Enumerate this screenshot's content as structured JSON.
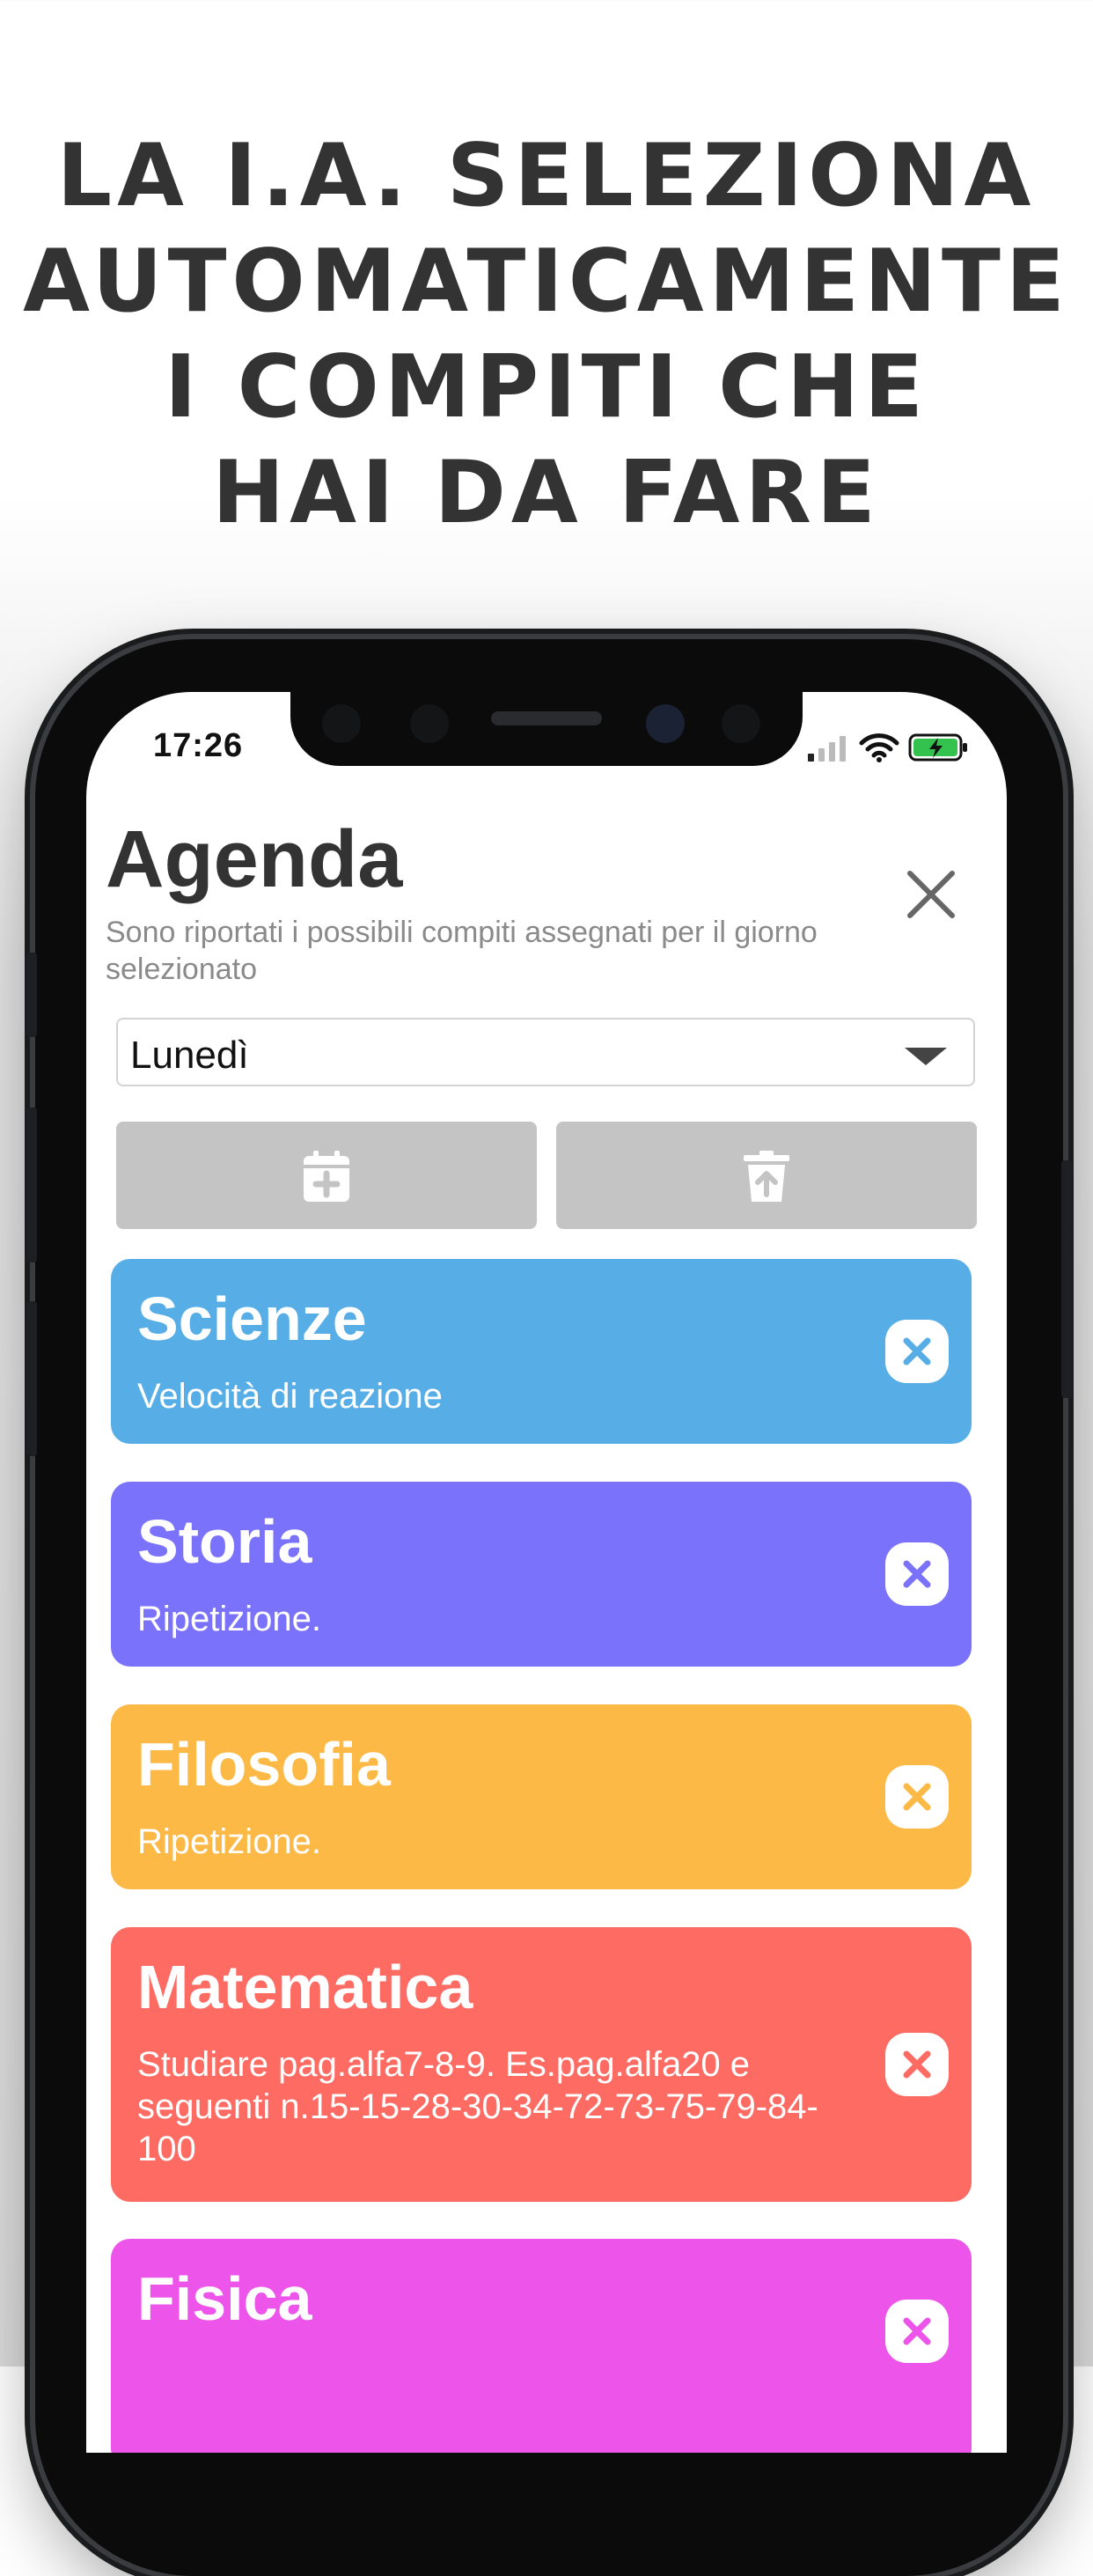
{
  "headline": [
    "LA I.A. SELEZIONA",
    "AUTOMATICAMENTE",
    "I COMPITI CHE",
    "HAI DA FARE"
  ],
  "status_bar": {
    "time": "17:26",
    "icons": [
      "cellular-signal-icon",
      "wifi-icon",
      "battery-charging-icon"
    ]
  },
  "screen": {
    "title": "Agenda",
    "subtitle": "Sono riportati i possibili compiti assegnati per il giorno selezionato",
    "close_icon": "close-icon",
    "day_select": {
      "selected": "Lunedì"
    },
    "toolbar": {
      "add_icon": "calendar-plus-icon",
      "delete_icon": "trash-upload-icon",
      "button_color": "#c4c4c4"
    },
    "cards": [
      {
        "subject": "Scienze",
        "task": "Velocità di reazione",
        "color": "#57aee6"
      },
      {
        "subject": "Storia",
        "task": "Ripetizione.",
        "color": "#7b72fb"
      },
      {
        "subject": "Filosofia",
        "task": "Ripetizione.",
        "color": "#fdb945"
      },
      {
        "subject": "Matematica",
        "task": "Studiare pag.alfa7-8-9. Es.pag.alfa20 e seguenti n.15-15-28-30-34-72-73-75-79-84-100",
        "color": "#fd6b63"
      },
      {
        "subject": "Fisica",
        "task": "",
        "color": "#ed55ea"
      }
    ]
  },
  "colors": {
    "headline_text": "#333333",
    "phone_frame": "#0b0b0c"
  }
}
